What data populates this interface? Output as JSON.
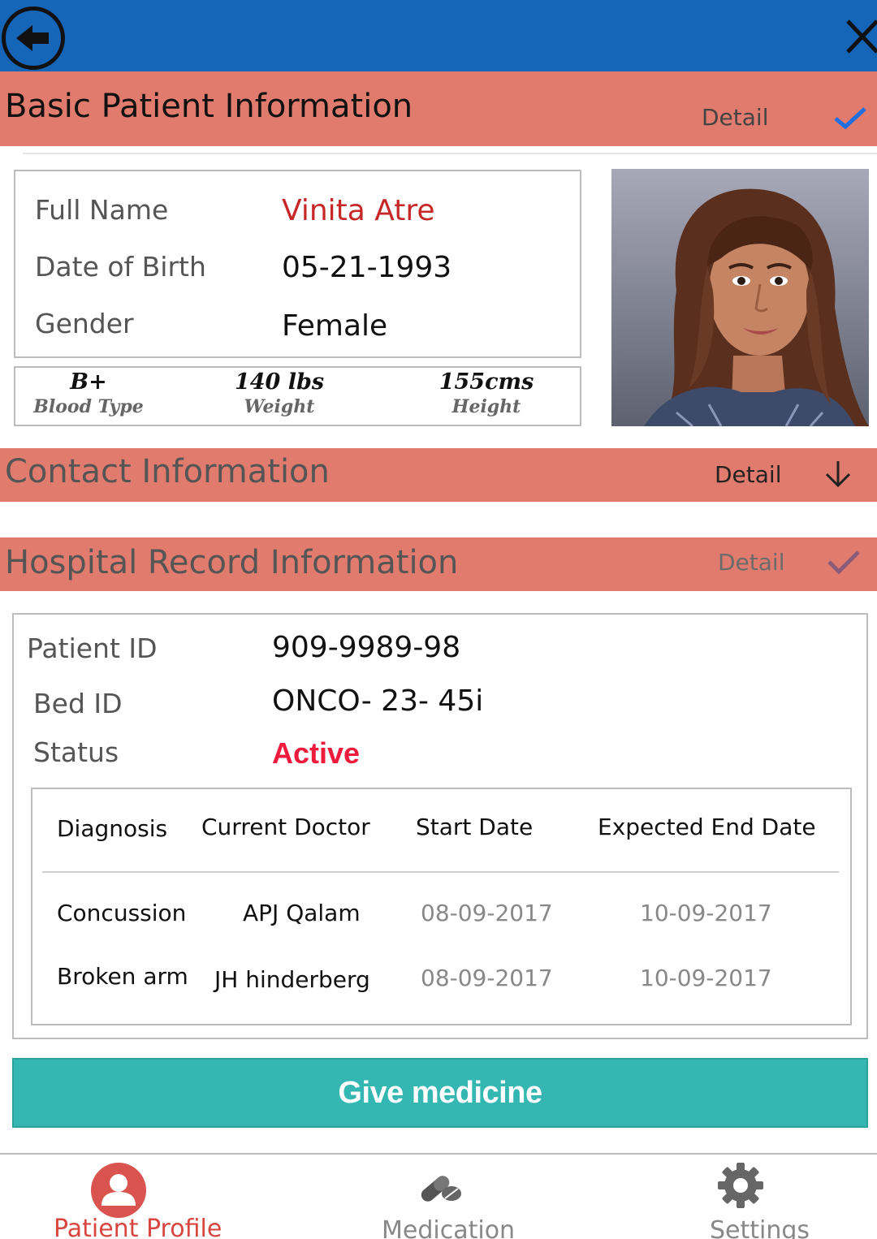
{
  "header": {
    "back_icon": "back-arrow-icon",
    "close_icon": "close-icon"
  },
  "colors": {
    "header_blue": "#1565b8",
    "section_bar": "#e07b6e",
    "accent_teal": "#34b7b2",
    "status_red": "#ef1b3c",
    "name_red": "#c62828"
  },
  "basic_info": {
    "title": "Basic Patient Information",
    "detail_label": "Detail",
    "check_icon": "checkmark-icon",
    "full_name_label": "Full Name",
    "full_name_value": "Vinita Atre",
    "dob_label": "Date of Birth",
    "dob_value": "05-21-1993",
    "gender_label": "Gender",
    "gender_value": "Female",
    "blood_type_value": "B+",
    "blood_type_label": "Blood Type",
    "weight_value": "140 lbs",
    "weight_label": "Weight",
    "height_value": "155cms",
    "height_label": "Height"
  },
  "contact_info": {
    "title": "Contact Information",
    "detail_label": "Detail",
    "expand_icon": "arrow-down-icon"
  },
  "hospital_record": {
    "title": "Hospital Record Information",
    "detail_label": "Detail",
    "check_icon": "checkmark-icon",
    "patient_id_label": "Patient ID",
    "patient_id_value": "909-9989-98",
    "bed_id_label": "Bed ID",
    "bed_id_value": "ONCO- 23- 45i",
    "status_label": "Status",
    "status_value": "Active",
    "table": {
      "headers": [
        "Diagnosis",
        "Current Doctor",
        "Start Date",
        "Expected End Date"
      ],
      "rows": [
        {
          "diagnosis": "Concussion",
          "doctor": "APJ Qalam",
          "start": "08-09-2017",
          "end": "10-09-2017"
        },
        {
          "diagnosis": "Broken arm",
          "doctor": "JH hinderberg",
          "start": "08-09-2017",
          "end": "10-09-2017"
        }
      ]
    }
  },
  "actions": {
    "give_medicine_label": "Give medicine"
  },
  "bottom_nav": {
    "items": [
      {
        "label": "Patient Profile",
        "icon": "user-icon",
        "active": true
      },
      {
        "label": "Medication",
        "icon": "pills-icon",
        "active": false
      },
      {
        "label": "Settings",
        "icon": "gear-icon",
        "active": false
      }
    ]
  }
}
